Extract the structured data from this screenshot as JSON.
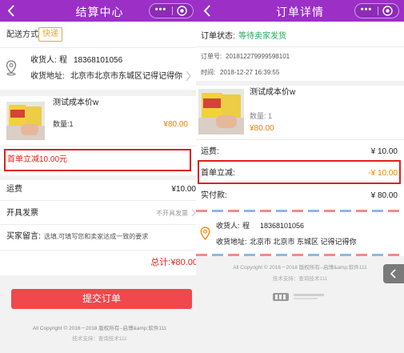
{
  "left": {
    "nav_title": "结算中心",
    "delivery": {
      "label": "配送方式",
      "value": "快递"
    },
    "address": {
      "name_label": "收货人:",
      "name": "程",
      "phone": "18368101056",
      "addr_label": "收货地址:",
      "addr": "北京市北京市东城区记得记得你"
    },
    "product": {
      "name": "测试成本价w",
      "qty_label": "数量:1",
      "price": "¥80.00"
    },
    "discount": "首单立减10.00元",
    "freight": {
      "label": "运费",
      "value": "¥10.00"
    },
    "invoice": {
      "label": "开具发票",
      "value": "不开具发票"
    },
    "message": {
      "label": "买家留言:",
      "placeholder": "选填,可填写您和卖家达成一致的要求"
    },
    "total": "总计:¥80.00",
    "submit_label": "提交订单",
    "copyright": "All Copyright © 2016－2018 版权所有--启博&amp;软件111",
    "support": "技术支持：查询技术111"
  },
  "right": {
    "nav_title": "订单详情",
    "status": {
      "label": "订单状态:",
      "value": "等待卖家发货"
    },
    "order_no": {
      "label": "订单号:",
      "value": "201812279999598101"
    },
    "time": {
      "label": "时间:",
      "value": "2018-12-27 16:39:55"
    },
    "product": {
      "name": "测试成本价w",
      "qty_label": "数量: 1",
      "price": "¥80.00"
    },
    "freight": {
      "label": "运费:",
      "value": "¥ 10.00"
    },
    "discount": {
      "label": "首单立减:",
      "value": "-¥ 10.00"
    },
    "paid": {
      "label": "实付款:",
      "value": "¥ 80.00"
    },
    "receiver": {
      "name_label": "收货人:",
      "name": "程",
      "phone": "18368101056",
      "addr_label": "收货地址:",
      "addr": "北京市 北京市 东城区 记得记得你"
    },
    "copyright": "All Copyright © 2016－2018 版权所有--启博&amp;软件111",
    "support": "技术支持：查询技术111"
  },
  "colors": {
    "nav_bg": "#9b2fc6",
    "accent_green": "#1aad5b",
    "price_orange": "#f08200",
    "highlight_red": "#e0211b",
    "submit_bg": "#f0484c"
  }
}
